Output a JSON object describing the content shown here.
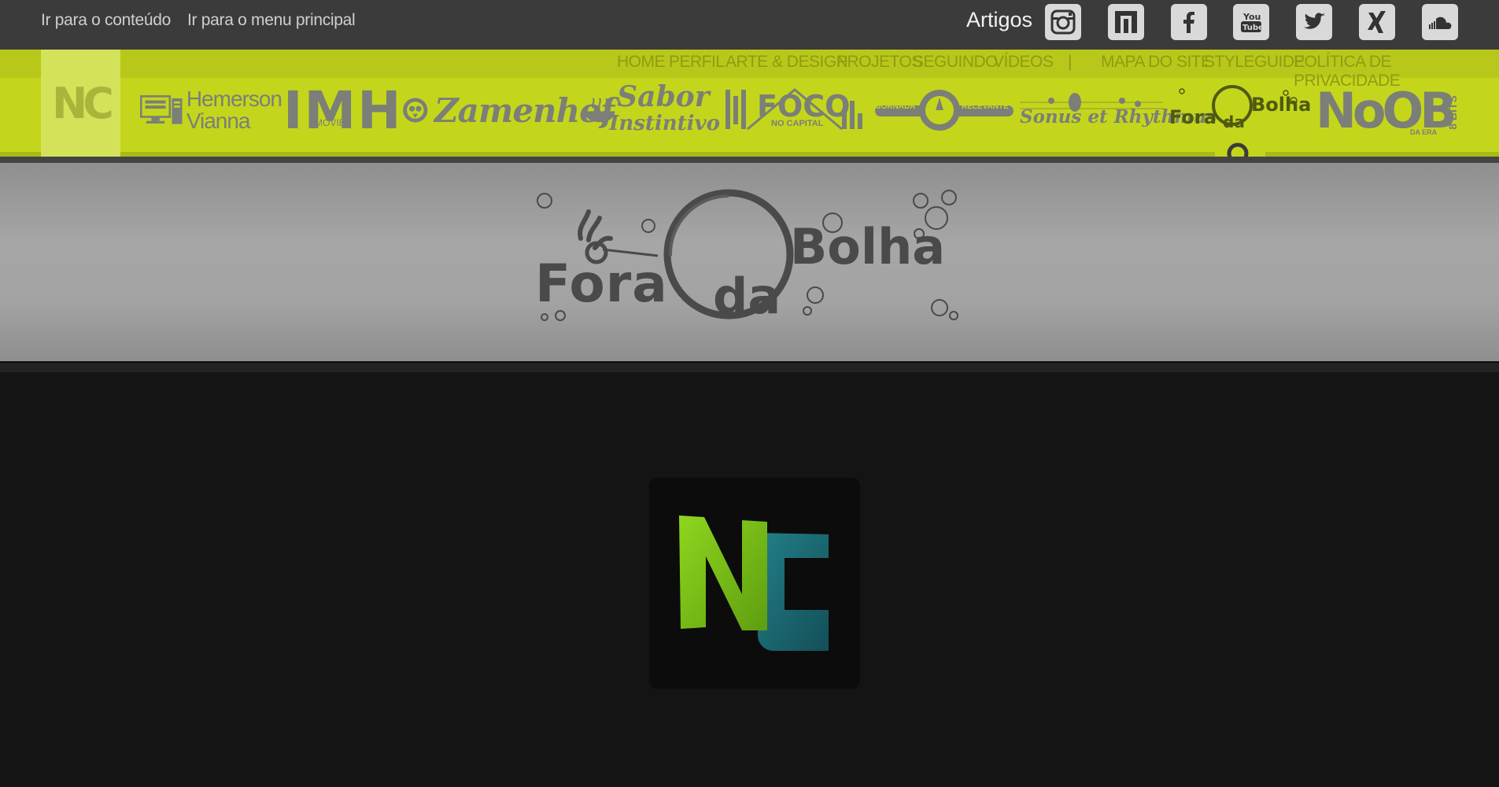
{
  "skip_links": {
    "content": "Ir para o conteúdo",
    "menu": "Ir para o menu principal"
  },
  "header": {
    "artigos": "Artigos",
    "social_icons": [
      "instagram-icon",
      "n-icon",
      "facebook-icon",
      "youtube-icon",
      "twitter-icon",
      "xing-icon",
      "soundcloud-icon"
    ]
  },
  "nav": {
    "primary": [
      "HOME",
      "PERFIL",
      "ARTE & DESIGN",
      "PROJETOS",
      "SEGUINDO",
      "VÍDEOS"
    ],
    "separator": "|",
    "secondary": [
      "MAPA DO SITE",
      "STYLEGUIDE",
      "POLÍTICA DE PRIVACIDADE"
    ]
  },
  "brand": {
    "small_logo": "NC"
  },
  "project_logos": {
    "hemerson_1": "Hemerson",
    "hemerson_2": "Vianna",
    "imh": "IMH",
    "imh_sub": "MOVIES",
    "zamenhof": "Zamenhof",
    "sabor_1": "Sabor",
    "sabor_2": "Instintivo",
    "foco": "FOCO",
    "foco_sub": "NO CAPITAL",
    "jornada": "JORNADA",
    "relevante": "RELEVANTE",
    "sonus": "Sonus et Rhythmus",
    "fora": "Fora",
    "da": "da",
    "bolha": "Bolha",
    "noob": "NoOB",
    "noob_sub": "DA ERA",
    "bits": "8 BITS"
  },
  "hero": {
    "fora": "Fora",
    "da": "da",
    "bolha": "Bolha"
  },
  "colors": {
    "topbar": "#3b3b3b",
    "accent_green": "#c4d61c",
    "nc_green": "#7ec21a",
    "nc_teal": "#1b6f78",
    "page_bg": "#141414"
  }
}
